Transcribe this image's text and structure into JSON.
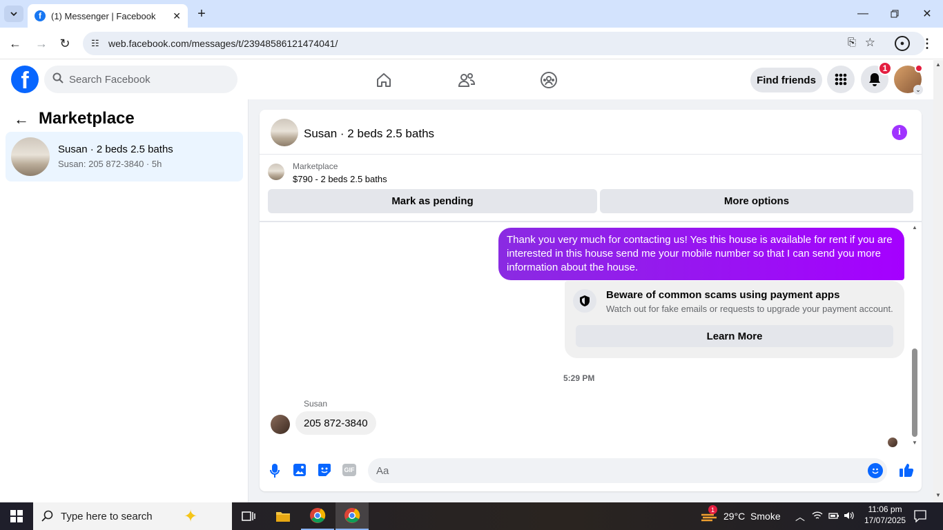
{
  "browser": {
    "tab_title": "(1) Messenger | Facebook",
    "url": "web.facebook.com/messages/t/23948586121474041/"
  },
  "fb": {
    "search_placeholder": "Search Facebook",
    "find_friends": "Find friends",
    "notif_count": "1"
  },
  "sidebar": {
    "title": "Marketplace",
    "conversation": {
      "name": "Susan · 2 beds 2.5 baths",
      "preview": "Susan: 205 872-3840 · 5h"
    }
  },
  "chat": {
    "header_title": "Susan · 2 beds 2.5 baths",
    "listing_source": "Marketplace",
    "listing_text": "$790 - 2 beds 2.5 baths",
    "mark_pending": "Mark as pending",
    "more_options": "More options",
    "outgoing_message": "Thank you very much for contacting us! Yes this house is available for rent if you are interested in this house send me your mobile number so that I can send you more information about the house.",
    "scam_title": "Beware of common scams using payment apps",
    "scam_body": "Watch out for fake emails or requests to upgrade your payment account.",
    "learn_more": "Learn More",
    "timestamp": "5:29 PM",
    "sender_name": "Susan",
    "incoming_message": "205 872-3840",
    "composer_placeholder": "Aa"
  },
  "taskbar": {
    "search_placeholder": "Type here to search",
    "weather": "29°C  Smoke",
    "weather_badge": "1",
    "time": "11:06 pm",
    "date": "17/07/2025"
  },
  "colors": {
    "fb_blue": "#0866ff",
    "messenger_purple": "#a033ff",
    "notif_red": "#e41e3f"
  }
}
